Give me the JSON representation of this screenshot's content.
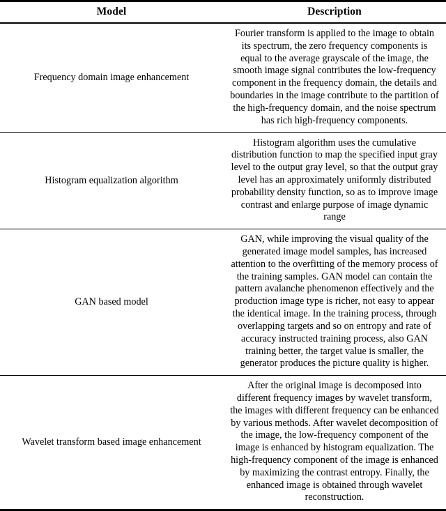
{
  "table": {
    "columns": [
      {
        "key": "model",
        "label": "Model"
      },
      {
        "key": "description",
        "label": "Description"
      }
    ],
    "rows": [
      {
        "model": "Frequency domain image enhancement",
        "description": "Fourier transform is applied to the image to obtain its spectrum, the zero frequency components is equal to the average grayscale of the image, the smooth image signal contributes the low-frequency component in the frequency domain, the details and boundaries in the image contribute to the partition of the high-frequency domain, and the noise spectrum has rich high-frequency components."
      },
      {
        "model": "Histogram equalization algorithm",
        "description": "Histogram algorithm uses the cumulative distribution function to map the specified input gray level to the output gray level, so that the output gray level has an approximately uniformly distributed probability density function, so as to improve image contrast and enlarge purpose of image dynamic range"
      },
      {
        "model": "GAN based model",
        "description": "GAN, while improving the visual quality of the generated image model samples, has increased attention to the overfitting of the memory process of the training samples. GAN model can contain the pattern avalanche phenomenon effectively and the production image type is richer, not easy to appear the identical image. In the training process, through overlapping targets and so on entropy and rate of accuracy instructed training process, also GAN training better, the target value is smaller, the generator produces the picture quality is higher."
      },
      {
        "model": "Wavelet transform based image enhancement",
        "description": "After the original image is decomposed into different frequency images by wavelet transform, the images with different frequency can be enhanced by various methods. After wavelet decomposition of the image, the low-frequency component of the image is enhanced by histogram equalization. The high-frequency component of the image is enhanced by maximizing the contrast entropy. Finally, the enhanced image is obtained through wavelet reconstruction."
      }
    ]
  },
  "style": {
    "text_color": "#000000",
    "background_color": "#ffffff",
    "rule_color": "#000000"
  }
}
